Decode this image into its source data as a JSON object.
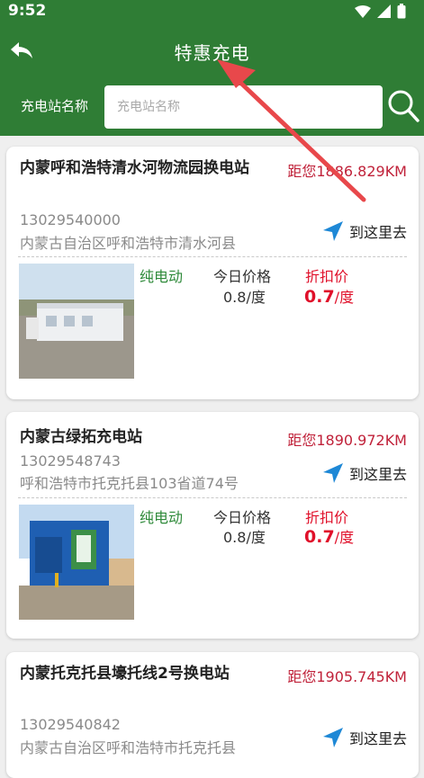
{
  "status_bar": {
    "time": "9:52"
  },
  "header": {
    "title": "特惠充电"
  },
  "search": {
    "label": "充电站名称",
    "placeholder": "充电站名称"
  },
  "colors": {
    "header_bg": "#2f7d35",
    "distance": "#c0223a",
    "discount": "#e0102a",
    "tag_green": "#2f8a3a",
    "arrow_red": "#e8484b",
    "nav_blue": "#1e88d6"
  },
  "stations": [
    {
      "name": "内蒙呼和浩特清水河物流园换电站",
      "distance": "距您1886.829KM",
      "phone": "13029540000",
      "address": "内蒙古自治区呼和浩特市清水河县",
      "goto_label": "到这里去",
      "type_tag": "纯电动",
      "price_label": "今日价格",
      "price_value": "0.8/度",
      "discount_label": "折扣价",
      "discount_value": "0.7",
      "discount_unit": "/度"
    },
    {
      "name": "内蒙古绿拓充电站",
      "distance": "距您1890.972KM",
      "phone": "13029548743",
      "address": "呼和浩特市托克托县103省道74号",
      "goto_label": "到这里去",
      "type_tag": "纯电动",
      "price_label": "今日价格",
      "price_value": "0.8/度",
      "discount_label": "折扣价",
      "discount_value": "0.7",
      "discount_unit": "/度"
    },
    {
      "name": "内蒙托克托县壕托线2号换电站",
      "distance": "距您1905.745KM",
      "phone": "13029540842",
      "address": "内蒙古自治区呼和浩特市托克托县",
      "goto_label": "到这里去"
    }
  ]
}
